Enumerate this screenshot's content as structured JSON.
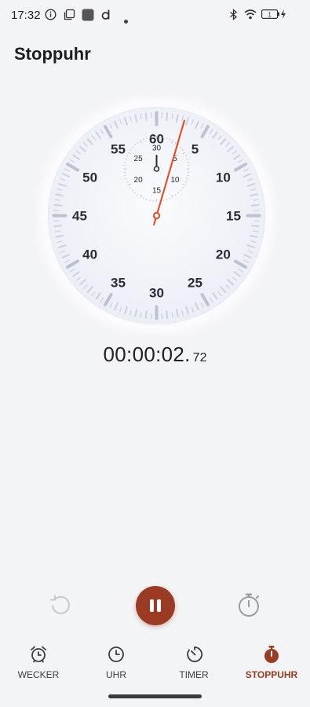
{
  "status_bar": {
    "time": "17:32",
    "battery_level": "1",
    "icons": [
      "info-icon",
      "screenshot-icon",
      "app-icon",
      "d-app-icon",
      "dot-icon",
      "bluetooth-icon",
      "wifi-icon",
      "battery-icon",
      "charging-icon"
    ]
  },
  "page": {
    "title": "Stoppuhr"
  },
  "dial": {
    "outer_labels": [
      "60",
      "5",
      "10",
      "15",
      "20",
      "25",
      "30",
      "35",
      "40",
      "45",
      "50",
      "55"
    ],
    "inner_labels": [
      "30",
      "5",
      "10",
      "15",
      "20",
      "25"
    ],
    "second_hand_seconds": 2.72,
    "inner_hand_minutes": 0,
    "accent_color": "#e8451e"
  },
  "readout": {
    "main": "00:00:02.",
    "hundredths": "72"
  },
  "controls": {
    "reset_icon": "reset-icon",
    "pause_icon": "pause-icon",
    "lap_icon": "stopwatch-lap-icon",
    "accent_color": "#9b3b23"
  },
  "nav": {
    "items": [
      {
        "label": "WECKER",
        "icon": "alarm-clock-icon",
        "active": false
      },
      {
        "label": "UHR",
        "icon": "clock-icon",
        "active": false
      },
      {
        "label": "TIMER",
        "icon": "timer-icon",
        "active": false
      },
      {
        "label": "STOPPUHR",
        "icon": "stopwatch-icon",
        "active": true
      }
    ]
  }
}
